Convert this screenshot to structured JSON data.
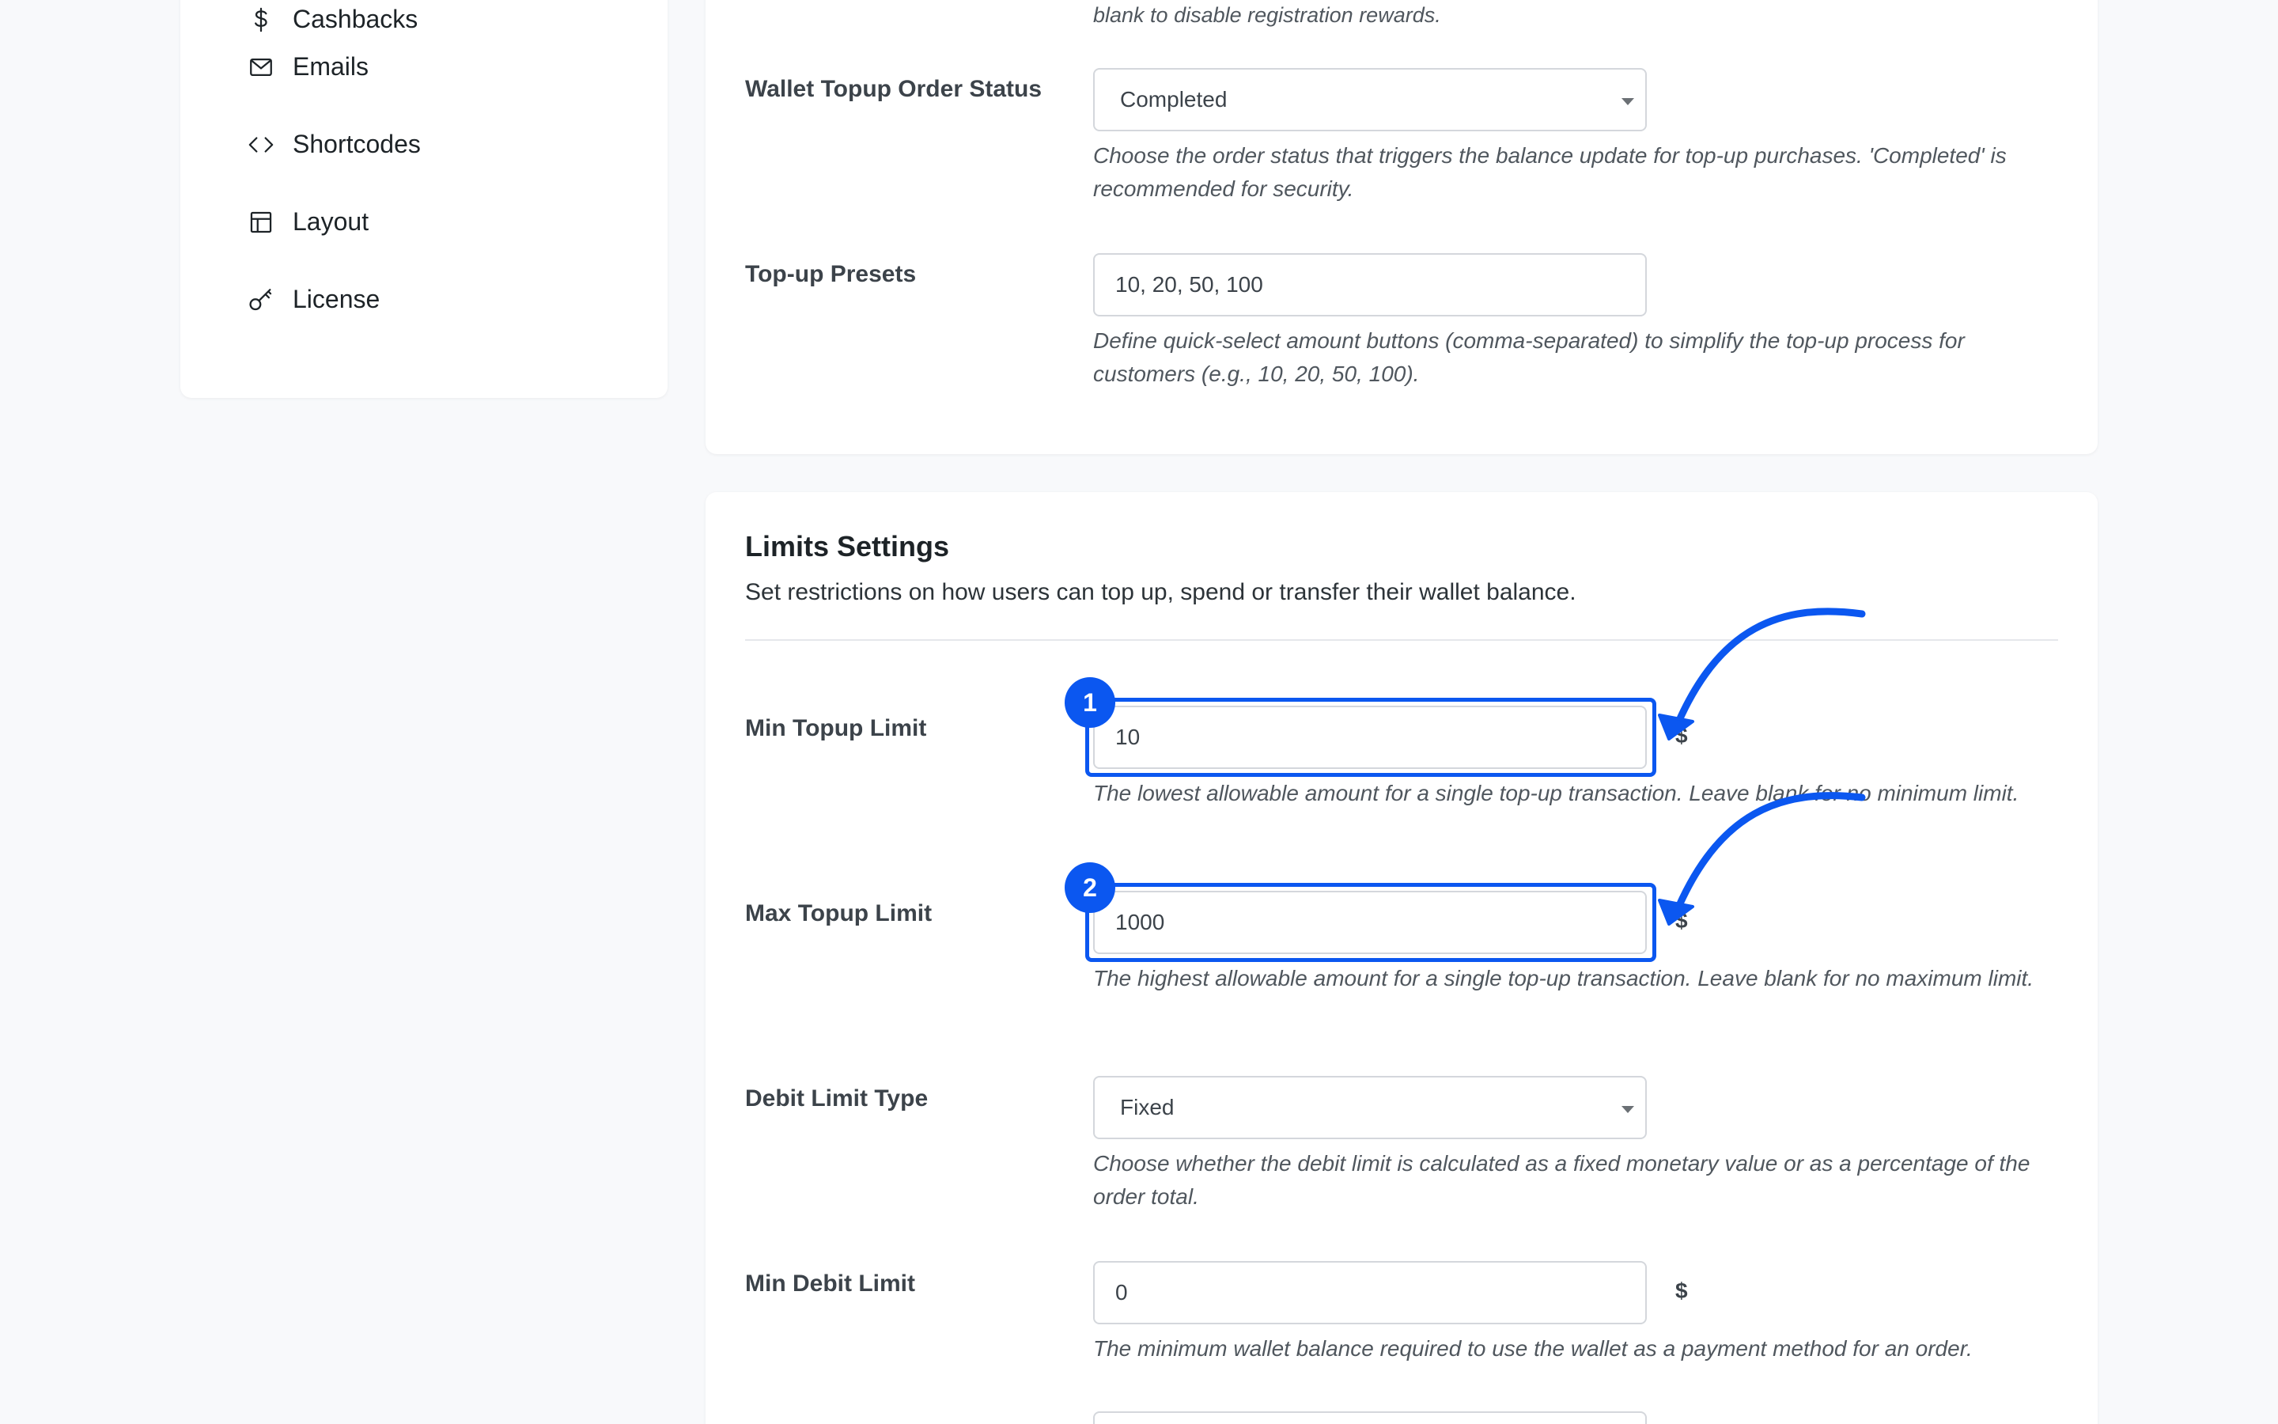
{
  "sidebar": {
    "items": [
      {
        "label": "Cashbacks",
        "icon": "dollar-icon"
      },
      {
        "label": "Emails",
        "icon": "mail-icon"
      },
      {
        "label": "Shortcodes",
        "icon": "code-icon"
      },
      {
        "label": "Layout",
        "icon": "layout-icon"
      },
      {
        "label": "License",
        "icon": "key-icon"
      }
    ]
  },
  "top_card": {
    "cutoff_help": "blank to disable registration rewards.",
    "wallet_topup_status": {
      "label": "Wallet Topup Order Status",
      "value": "Completed",
      "help": "Choose the order status that triggers the balance update for top-up purchases. 'Completed' is recommended for security."
    },
    "topup_presets": {
      "label": "Top-up Presets",
      "value": "10, 20, 50, 100",
      "help": "Define quick-select amount buttons (comma-separated) to simplify the top-up process for customers (e.g., 10, 20, 50, 100)."
    }
  },
  "limits": {
    "title": "Limits Settings",
    "description": "Set restrictions on how users can top up, spend or transfer their wallet balance.",
    "min_topup": {
      "label": "Min Topup Limit",
      "value": "10",
      "unit": "$",
      "badge": "1",
      "help": "The lowest allowable amount for a single top-up transaction. Leave blank for no minimum limit."
    },
    "max_topup": {
      "label": "Max Topup Limit",
      "value": "1000",
      "unit": "$",
      "badge": "2",
      "help": "The highest allowable amount for a single top-up transaction. Leave blank for no maximum limit."
    },
    "debit_limit_type": {
      "label": "Debit Limit Type",
      "value": "Fixed",
      "help": "Choose whether the debit limit is calculated as a fixed monetary value or as a percentage of the order total."
    },
    "min_debit": {
      "label": "Min Debit Limit",
      "value": "0",
      "unit": "$",
      "help": "The minimum wallet balance required to use the wallet as a payment method for an order."
    }
  },
  "colors": {
    "accent": "#0b57f0",
    "label": "#3c434a",
    "help": "#50575e",
    "background": "#f8f9fb"
  }
}
